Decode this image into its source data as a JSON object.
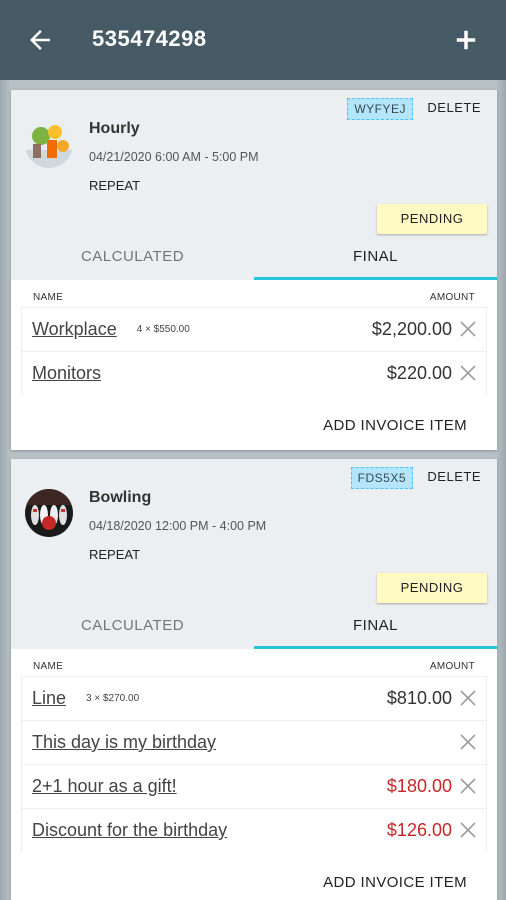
{
  "header": {
    "title": "535474298",
    "back_icon": "arrow-left-icon",
    "add_icon": "plus-icon"
  },
  "columns": {
    "name": "NAME",
    "amount": "AMOUNT"
  },
  "cards": [
    {
      "name": "Hourly",
      "time": "04/21/2020 6:00 AM - 5:00 PM",
      "repeat": "REPEAT",
      "code": "WYFYEJ",
      "delete": "DELETE",
      "status": "PENDING",
      "tabs": [
        "CALCULATED",
        "FINAL"
      ],
      "active_tab": "FINAL",
      "items": [
        {
          "name": "Workplace",
          "qty": "4 × $550.00",
          "amount": "$2,200.00",
          "red": false
        },
        {
          "name": "Monitors",
          "qty": "",
          "amount": "$220.00",
          "red": false
        }
      ],
      "add_item": "ADD INVOICE ITEM"
    },
    {
      "name": "Bowling",
      "time": "04/18/2020 12:00 PM - 4:00 PM",
      "repeat": "REPEAT",
      "code": "FDS5X5",
      "delete": "DELETE",
      "status": "PENDING",
      "tabs": [
        "CALCULATED",
        "FINAL"
      ],
      "active_tab": "FINAL",
      "items": [
        {
          "name": "Line",
          "qty": "3 × $270.00",
          "amount": "$810.00",
          "red": false
        },
        {
          "name": "This day is my birthday",
          "qty": "",
          "amount": "",
          "red": false
        },
        {
          "name": "2+1 hour as a gift!",
          "qty": "",
          "amount": "$180.00",
          "red": true
        },
        {
          "name": "Discount for the birthday",
          "qty": "",
          "amount": "$126.00",
          "red": true
        }
      ],
      "add_item": "ADD INVOICE ITEM"
    }
  ],
  "colors": {
    "appbar": "#455a64",
    "tab_indicator": "#26c6da",
    "pending": "#fff9c4",
    "negative": "#c62828"
  }
}
